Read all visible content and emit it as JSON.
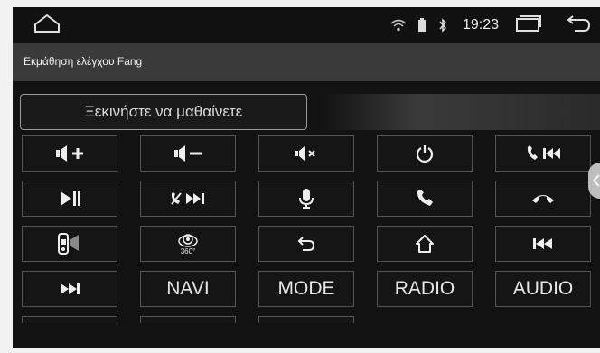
{
  "status": {
    "time": "19:23",
    "icons": [
      "home-icon",
      "wifi-icon",
      "battery-icon",
      "bluetooth-icon",
      "recent-apps-icon",
      "back-icon"
    ]
  },
  "title": "Εκμάθηση ελέγχου Fang",
  "start_button": "Ξεκινήστε να μαθαίνετε",
  "keys": [
    [
      "volume-up-icon",
      "volume-down-icon",
      "mute-icon",
      "power-icon",
      "call-previous-icon"
    ],
    [
      "play-pause-icon",
      "hangup-next-icon",
      "voice-mic-icon",
      "call-answer-icon",
      "call-end-icon"
    ],
    [
      "car-speaker-icon",
      "camera-360-icon",
      "return-icon",
      "home-icon",
      "previous-track-icon"
    ],
    [
      "next-track-icon",
      "NAVI",
      "MODE",
      "RADIO",
      "AUDIO"
    ]
  ],
  "labels": {
    "navi": "NAVI",
    "mode": "MODE",
    "radio": "RADIO",
    "audio": "AUDIO",
    "camera_360": "360°"
  }
}
